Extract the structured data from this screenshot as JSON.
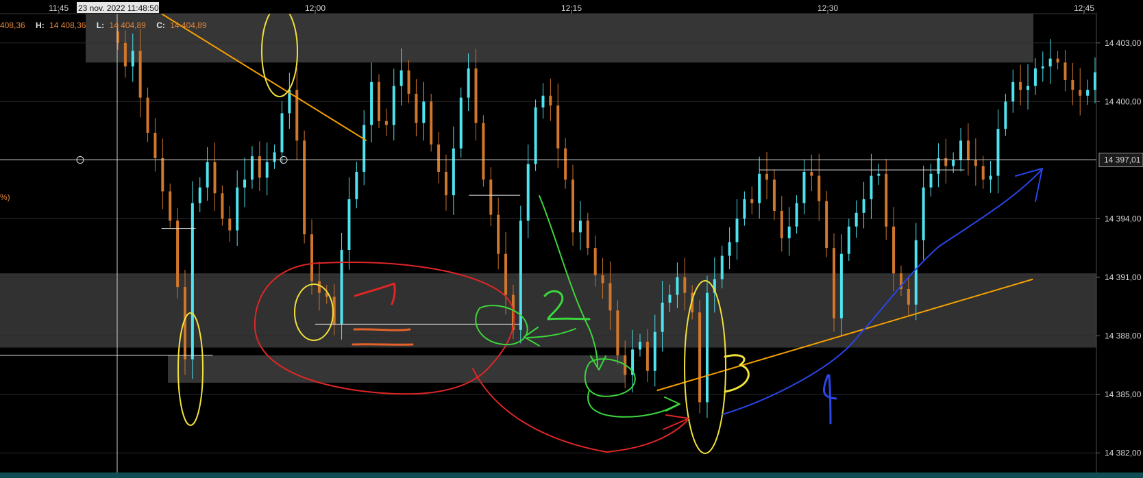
{
  "crosshair_time": "23 nov. 2022 11:48:50",
  "ohlc": {
    "open_value": "408,36",
    "high_label": "H:",
    "high_value": "14 408,36",
    "low_label": "L:",
    "low_value": "14 404,89",
    "close_label": "C:",
    "close_value": "14 404,89"
  },
  "indicator_fragment": "%)",
  "colors": {
    "background": "#000000",
    "up_candle": "#4ee3ee",
    "down_candle": "#d0772c",
    "zone": "#5a5a5a",
    "grid": "#2a2a2a",
    "trendline": "#f5a000"
  },
  "chart_data": {
    "type": "candlestick",
    "x_axis": {
      "ticks": [
        "11:45",
        "12:00",
        "12:15",
        "12:30",
        "12:45"
      ]
    },
    "y_axis": {
      "ticks": [
        "14 403,00",
        "14 400,00",
        "14 394,00",
        "14 391,00",
        "14 388,00",
        "14 385,00",
        "14 382,00"
      ],
      "range": [
        14381.0,
        14404.5
      ]
    },
    "current_price": {
      "value": 14397.01,
      "label": "14 397,01"
    },
    "price_zones": [
      {
        "from": 14402.0,
        "to": 14404.5
      },
      {
        "from": 14387.4,
        "to": 14391.2
      },
      {
        "from": 14385.6,
        "to": 14387.0
      }
    ],
    "trendlines": [
      {
        "from": {
          "time": "11:51",
          "price": 14404.5
        },
        "to": {
          "time": "12:03",
          "price": 14398.0
        }
      },
      {
        "from": {
          "time": "12:20",
          "price": 14385.2
        },
        "to": {
          "time": "12:42",
          "price": 14390.9
        }
      }
    ],
    "reference_levels": [
      {
        "price": 14393.5,
        "from": "11:51",
        "to": "11:53"
      },
      {
        "price": 14395.2,
        "from": "12:09",
        "to": "12:12"
      },
      {
        "price": 14388.6,
        "from": "12:00",
        "to": "12:12"
      },
      {
        "price": 14396.5,
        "from": "12:26",
        "to": "12:38"
      },
      {
        "price": 14387.0,
        "from": "11:38",
        "to": "11:54"
      }
    ],
    "candles_note": "1-minute style candles, approximated from the image",
    "closes": [
      14403.0,
      14401.8,
      14402.6,
      14400.2,
      14398.4,
      14397.1,
      14395.4,
      14393.9,
      14390.5,
      14386.8,
      14394.8,
      14395.6,
      14396.9,
      14395.3,
      14394.0,
      14393.4,
      14395.6,
      14396.0,
      14397.2,
      14396.1,
      14396.9,
      14397.4,
      14399.4,
      14400.6,
      14398.0,
      14393.2,
      14390.8,
      14390.2,
      14390.0,
      14388.6,
      14392.4,
      14395.0,
      14396.4,
      14398.8,
      14401.0,
      14399.0,
      14398.8,
      14400.8,
      14401.6,
      14400.4,
      14398.9,
      14400.0,
      14397.8,
      14396.4,
      14395.2,
      14397.6,
      14400.2,
      14401.7,
      14398.9,
      14396.0,
      14394.2,
      14392.2,
      14390.1,
      14388.3,
      14393.9,
      14396.8,
      14399.7,
      14400.3,
      14399.8,
      14397.6,
      14396.0,
      14393.3,
      14393.9,
      14392.5,
      14391.1,
      14390.7,
      14389.3,
      14387.0,
      14386.0,
      14387.3,
      14387.7,
      14386.2,
      14388.2,
      14389.7,
      14390.1,
      14391.0,
      14390.2,
      14389.2,
      14384.6,
      14390.2,
      14390.9,
      14392.1,
      14392.8,
      14394.0,
      14395.0,
      14394.8,
      14396.3,
      14396.0,
      14394.4,
      14393.0,
      14393.6,
      14394.8,
      14396.4,
      14396.2,
      14394.9,
      14392.5,
      14388.9,
      14392.2,
      14393.6,
      14394.3,
      14395.0,
      14396.2,
      14396.3,
      14393.6,
      14391.2,
      14390.4,
      14389.6,
      14392.9,
      14395.6,
      14396.3,
      14397.1,
      14396.7,
      14397.0,
      14398.0,
      14397.0,
      14396.7,
      14396.0,
      14396.2,
      14398.6,
      14400.0,
      14401.0,
      14400.6,
      14400.8,
      14401.7,
      14401.8,
      14402.2,
      14402.0,
      14401.1,
      14400.6,
      14400.3,
      14400.6,
      14401.5
    ]
  }
}
